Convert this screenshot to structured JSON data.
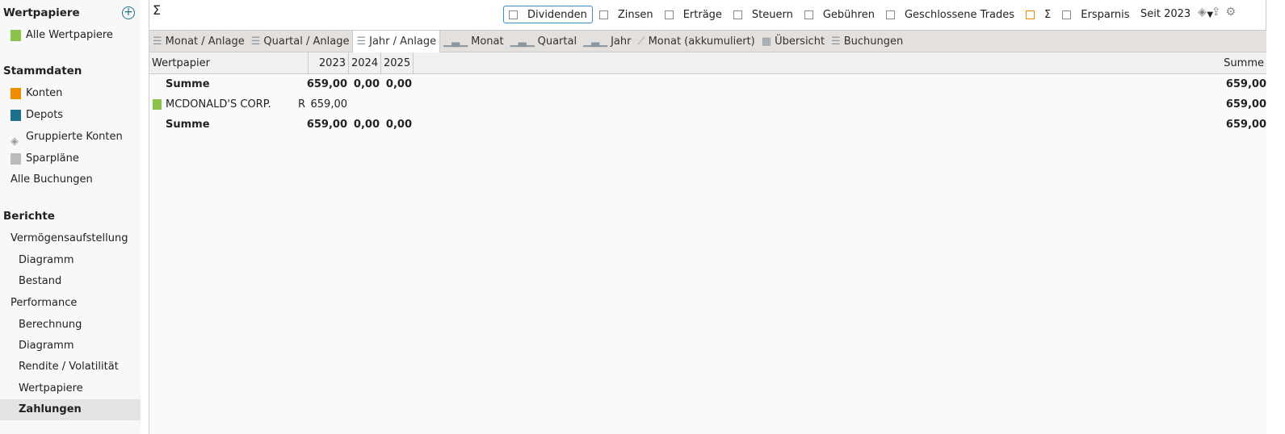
{
  "sidebar": {
    "wertpapiere": "Wertpapiere",
    "alle_wertpapiere": "Alle Wertpapiere",
    "stammdaten": "Stammdaten",
    "konten": "Konten",
    "depots": "Depots",
    "gruppierte": "Gruppierte Konten",
    "sparplaene": "Sparpläne",
    "alle_buchungen": "Alle Buchungen",
    "berichte": "Berichte",
    "vermoegen": "Vermögensaufstellung",
    "diagramm1": "Diagramm",
    "bestand": "Bestand",
    "performance": "Performance",
    "berechnung": "Berechnung",
    "diagramm2": "Diagramm",
    "rendite": "Rendite / Volatilität",
    "wertpapiere2": "Wertpapiere",
    "zahlungen": "Zahlungen"
  },
  "header": {
    "sigma": "Σ",
    "filters": [
      "Dividenden",
      "Zinsen",
      "Erträge",
      "Steuern",
      "Gebühren",
      "Geschlossene Trades",
      "Σ",
      "Ersparnis"
    ],
    "period": "Seit 2023"
  },
  "tabs": [
    "Monat / Anlage",
    "Quartal / Anlage",
    "Jahr / Anlage",
    "Monat",
    "Quartal",
    "Jahr",
    "Monat (akkumuliert)",
    "Übersicht",
    "Buchungen"
  ],
  "table": {
    "columns": [
      "Wertpapier",
      "2023",
      "2024",
      "2025",
      "Summe"
    ],
    "rows": [
      {
        "name": "Summe",
        "flag": "",
        "v": [
          "659,00",
          "0,00",
          "0,00"
        ],
        "sum": "659,00"
      },
      {
        "name": "MCDONALD'S CORP.",
        "flag": "R",
        "v": [
          "659,00",
          "",
          ""
        ],
        "sum": "659,00"
      },
      {
        "name": "Summe",
        "flag": "",
        "v": [
          "659,00",
          "0,00",
          "0,00"
        ],
        "sum": "659,00"
      }
    ]
  },
  "colors": {
    "orange": "#f08c00",
    "teal": "#1e6f8a",
    "green": "#8bc34a"
  }
}
